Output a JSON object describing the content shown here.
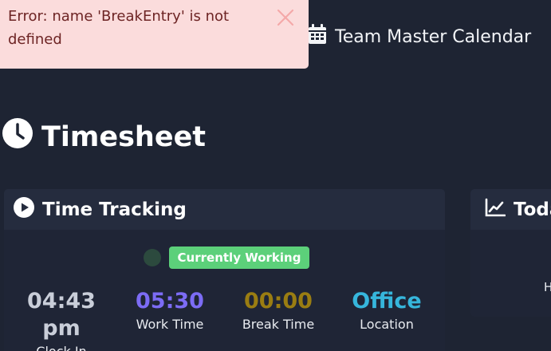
{
  "alert": {
    "message": "Error: name 'BreakEntry' is not defined"
  },
  "nav": {
    "calendar_label": "Team Master Calendar"
  },
  "page": {
    "title": "Timesheet"
  },
  "time_tracking": {
    "title": "Time Tracking",
    "status": "Currently Working",
    "stats": [
      {
        "value": "04:43 pm",
        "label": "Clock In",
        "color": "#c9ced9"
      },
      {
        "value": "05:30",
        "label": "Work Time",
        "color": "#7c6cf5"
      },
      {
        "value": "00:00",
        "label": "Break Time",
        "color": "#9a7d12"
      },
      {
        "value": "Office",
        "label": "Location",
        "color": "#36b6dc"
      }
    ]
  },
  "today_card": {
    "title": "Toda",
    "stub": "H"
  },
  "colors": {
    "background": "#1e2433",
    "alert_bg": "#fbdcdc",
    "alert_text": "#6d2424",
    "success": "#5cd07a"
  }
}
